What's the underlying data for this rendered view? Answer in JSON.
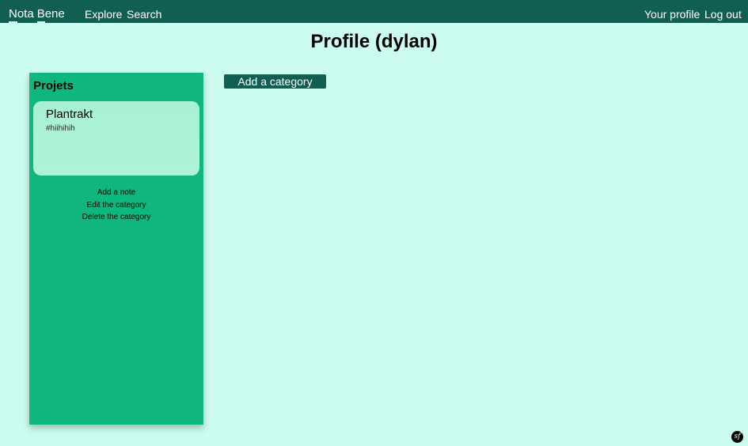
{
  "nav": {
    "brand": {
      "first_cap": "N",
      "first_rest": "ota",
      "second_cap": "B",
      "second_rest": "ene"
    },
    "links": {
      "explore": "Explore",
      "search": "Search",
      "profile": "Your profile",
      "logout": "Log out"
    }
  },
  "page": {
    "title": "Profile (dylan)"
  },
  "categories": [
    {
      "name": "Projets",
      "notes": [
        {
          "title": "Plantrakt",
          "tags": "#hiihihih"
        }
      ],
      "actions": {
        "add_note": "Add a note",
        "edit": "Edit the category",
        "delete": "Delete the category"
      }
    }
  ],
  "main": {
    "add_category_label": "Add a category"
  },
  "debug_toolbar": {
    "icon": "symfony-icon",
    "glyph": "sf"
  },
  "colors": {
    "page_background": "#ccfbef",
    "nav_background": "#115e52",
    "category_background": "#0fb67d",
    "note_card_background": "#a8f1d4",
    "button_background": "#115e52"
  }
}
